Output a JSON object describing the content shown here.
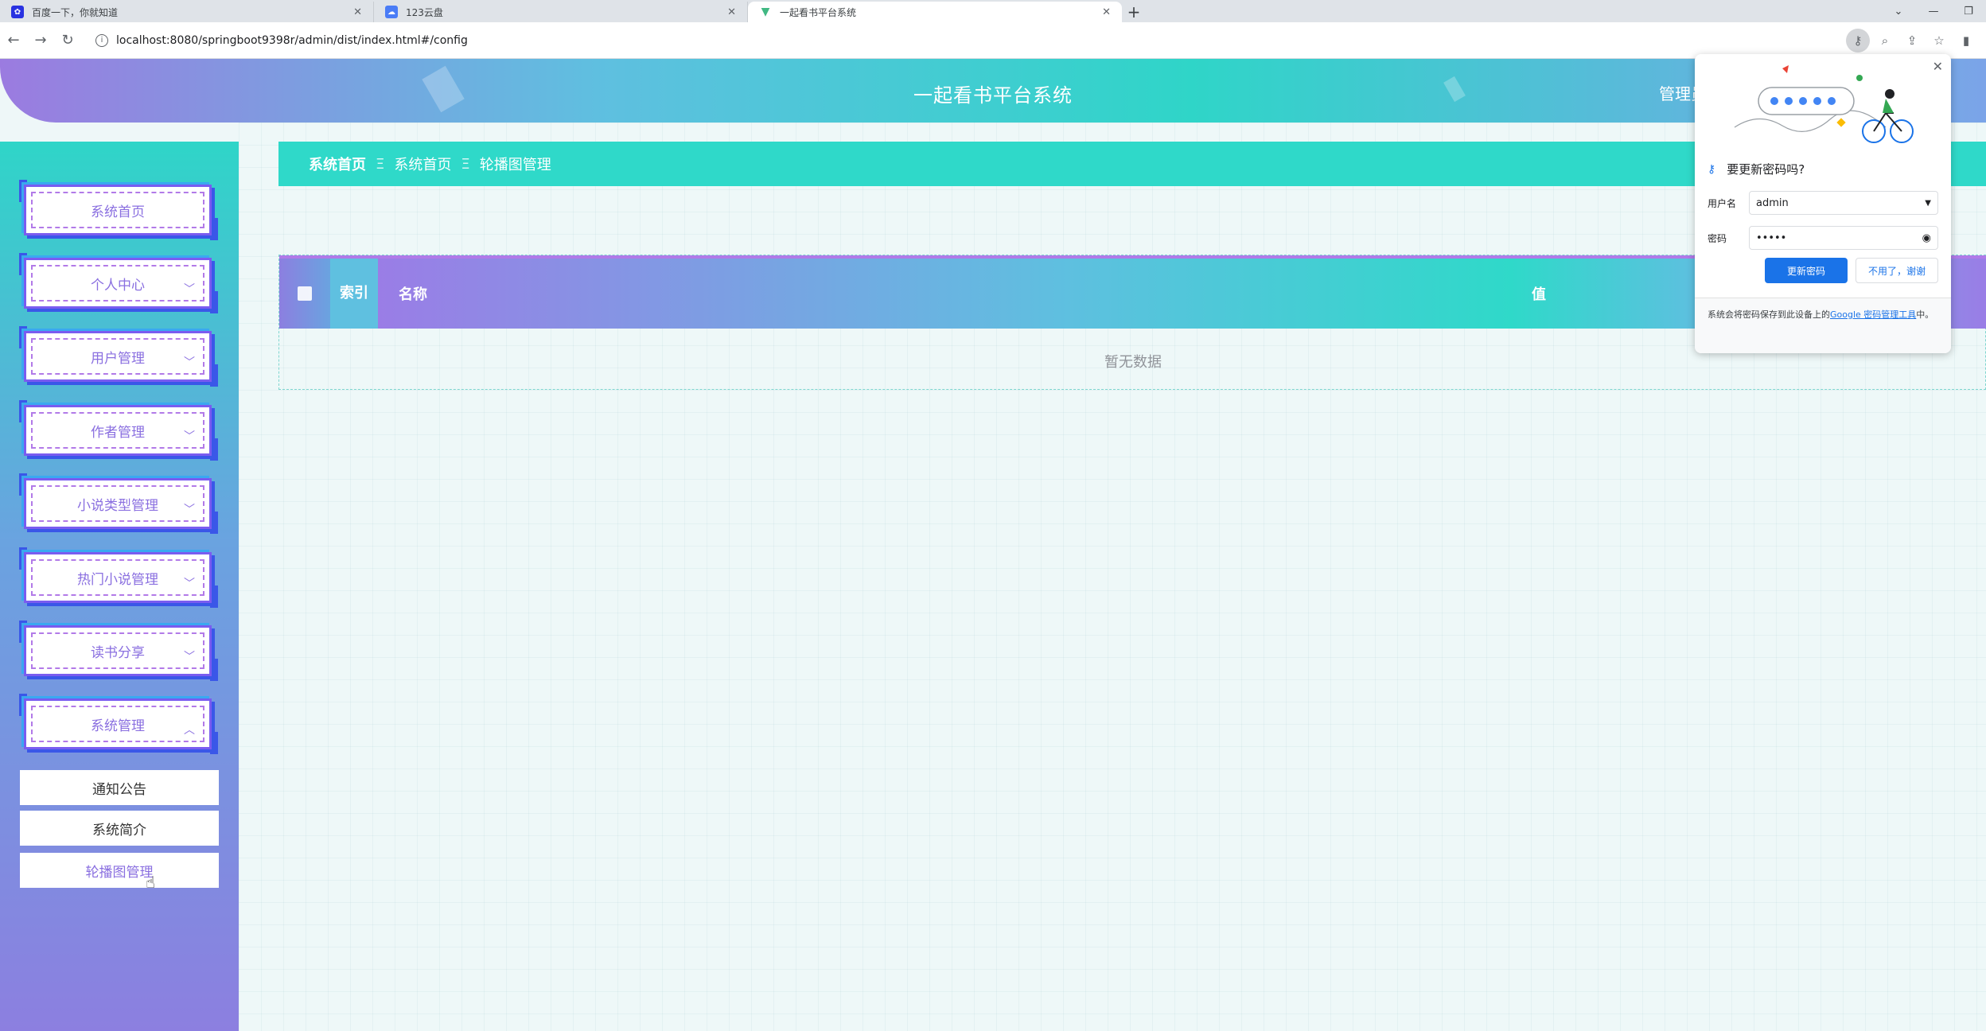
{
  "browser": {
    "tabs": [
      {
        "title": "百度一下，你就知道",
        "icon": "baidu-icon",
        "active": false
      },
      {
        "title": "123云盘",
        "icon": "cloud-drive-icon",
        "active": false
      },
      {
        "title": "一起看书平台系统",
        "icon": "vue-icon",
        "active": true
      }
    ],
    "url": "localhost:8080/springboot9398r/admin/dist/index.html#/config"
  },
  "header": {
    "title": "一起看书平台系统",
    "user_text": "管理员"
  },
  "sidebar": {
    "items": [
      {
        "label": "系统首页",
        "has_chevron": false
      },
      {
        "label": "个人中心",
        "has_chevron": true
      },
      {
        "label": "用户管理",
        "has_chevron": true
      },
      {
        "label": "作者管理",
        "has_chevron": true
      },
      {
        "label": "小说类型管理",
        "has_chevron": true
      },
      {
        "label": "热门小说管理",
        "has_chevron": true
      },
      {
        "label": "读书分享",
        "has_chevron": true
      },
      {
        "label": "系统管理",
        "has_chevron": true,
        "expanded": true
      }
    ],
    "sub_items": [
      {
        "label": "通知公告"
      },
      {
        "label": "系统简介"
      },
      {
        "label": "轮播图管理",
        "active": true
      }
    ]
  },
  "breadcrumb": {
    "home": "系统首页",
    "sep": "Ξ",
    "items": [
      "系统首页",
      "轮播图管理"
    ]
  },
  "table": {
    "columns": {
      "index": "索引",
      "name": "名称",
      "value": "值"
    },
    "empty_text": "暂无数据"
  },
  "password_popup": {
    "title": "要更新密码吗?",
    "username_label": "用户名",
    "username_value": "admin",
    "password_label": "密码",
    "password_value": "•••••",
    "primary_button": "更新密码",
    "secondary_button": "不用了，谢谢",
    "footer_text": "系统会将密码保存到此设备上的",
    "footer_link": "Google 密码管理工具",
    "footer_suffix": "中。"
  },
  "colors": {
    "accent_teal": "#2fd9c9",
    "accent_purple": "#8a6fe0",
    "chrome_blue": "#1a73e8"
  }
}
